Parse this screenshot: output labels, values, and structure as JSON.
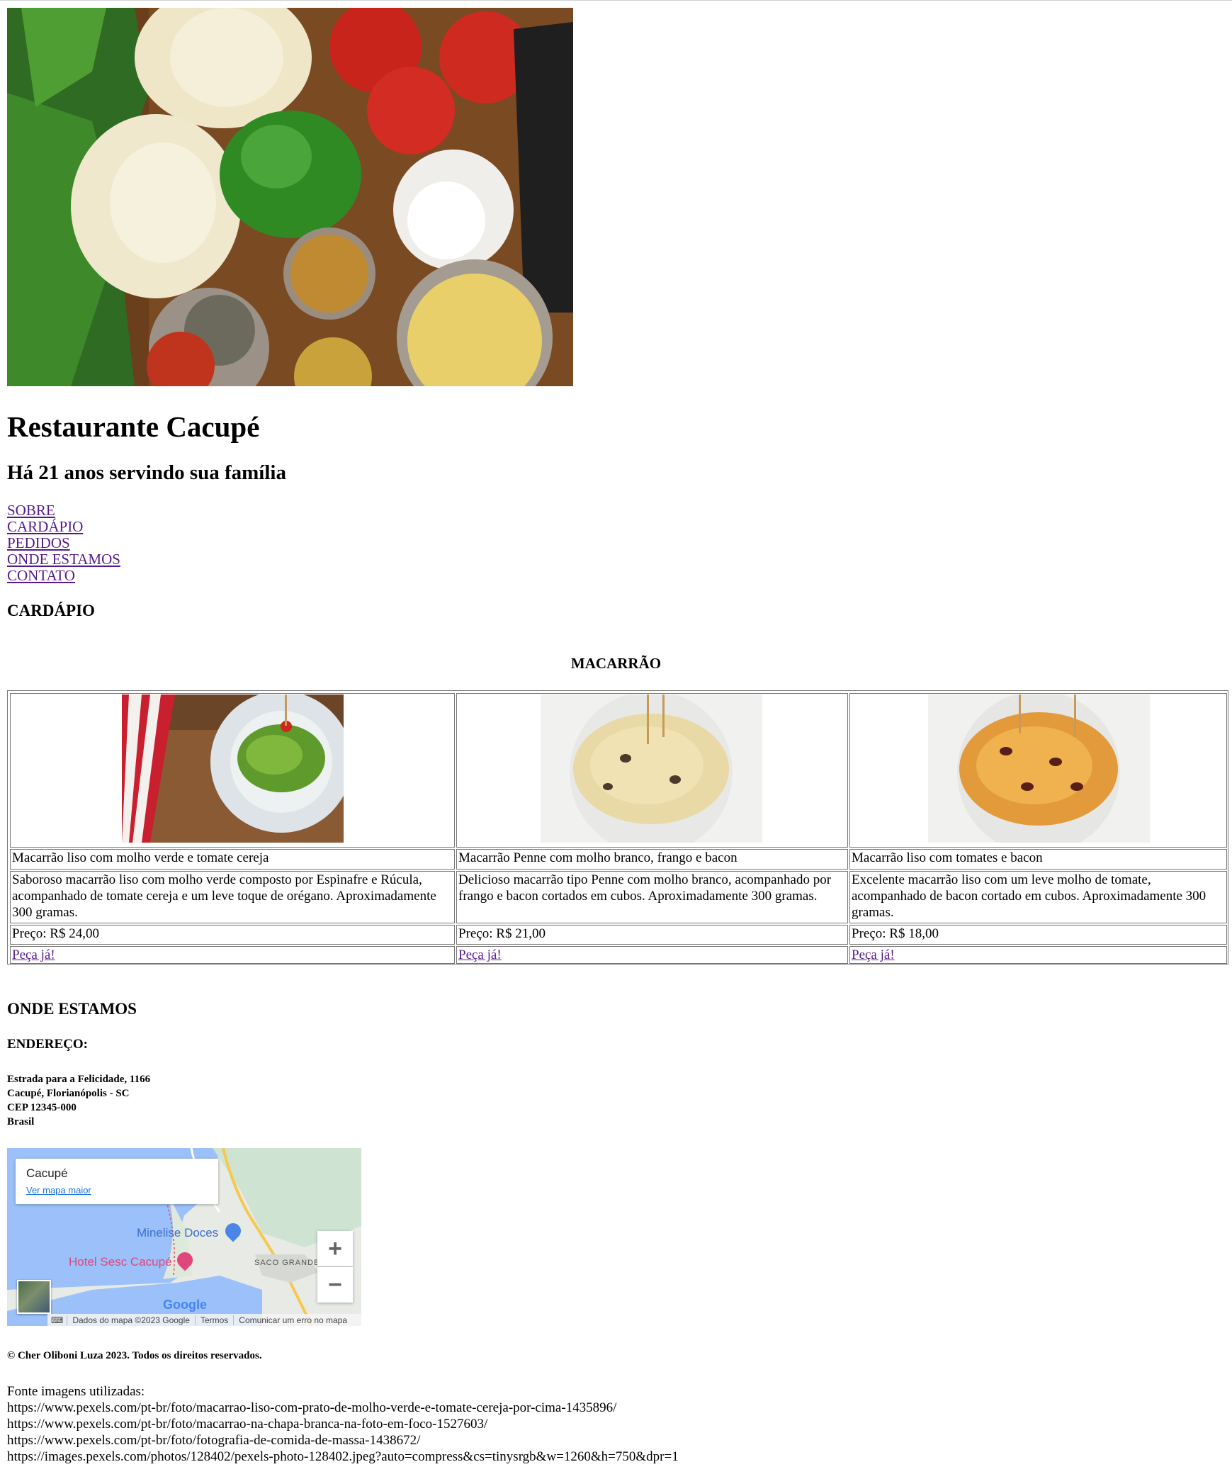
{
  "header": {
    "title": "Restaurante Cacupé",
    "subtitle": "Há 21 anos servindo sua família"
  },
  "nav": {
    "items": [
      {
        "label": "SOBRE"
      },
      {
        "label": "CARDÁPIO"
      },
      {
        "label": "PEDIDOS"
      },
      {
        "label": "ONDE ESTAMOS"
      },
      {
        "label": "CONTATO"
      }
    ]
  },
  "menu": {
    "heading": "CARDÁPIO",
    "category": "MACARRÃO",
    "dishes": [
      {
        "name": "Macarrão liso com molho verde e tomate cereja",
        "description": "Saboroso macarrão liso com molho verde composto por Espinafre e Rúcula, acompanhado de tomate cereja e um leve toque de orégano. Aproximadamente 300 gramas.",
        "price": "Preço: R$ 24,00",
        "order_label": "Peça já!"
      },
      {
        "name": "Macarrão Penne com molho branco, frango e bacon",
        "description": "Delicioso macarrão tipo Penne com molho branco, acompanhado por frango e bacon cortados em cubos. Aproximadamente 300 gramas.",
        "price": "Preço: R$ 21,00",
        "order_label": "Peça já!"
      },
      {
        "name": "Macarrão liso com tomates e bacon",
        "description": "Excelente macarrão liso com um leve molho de tomate, acompanhado de bacon cortado em cubos. Aproximadamente 300 gramas.",
        "price": "Preço: R$ 18,00",
        "order_label": "Peça já!"
      }
    ]
  },
  "location": {
    "heading": "ONDE ESTAMOS",
    "address_heading": "ENDEREÇO:",
    "address_lines": [
      "Estrada para a Felicidade, 1166",
      "Cacupé, Florianópolis - SC",
      "CEP 12345-000",
      "Brasil"
    ],
    "map": {
      "place_name": "Cacupé",
      "larger_map_link": "Ver mapa maior",
      "labels": {
        "poi_1": "Minelise Doces",
        "poi_2": "Hotel Sesc Cacupé",
        "area": "SACO GRANDE",
        "brand": "Google"
      },
      "zoom_in": "+",
      "zoom_out": "−",
      "footer": {
        "data": "Dados do mapa ©2023 Google",
        "terms": "Termos",
        "report": "Comunicar um erro no mapa"
      },
      "icons": [
        "shopping-bag-icon",
        "hotel-bed-icon",
        "keyboard-icon"
      ]
    }
  },
  "footer": {
    "copyright": "© Cher Oliboni Luza 2023. Todos os direitos reservados.",
    "sources_label": "Fonte imagens utilizadas:",
    "sources": [
      "https://www.pexels.com/pt-br/foto/macarrao-liso-com-prato-de-molho-verde-e-tomate-cereja-por-cima-1435896/",
      "https://www.pexels.com/pt-br/foto/macarrao-na-chapa-branca-na-foto-em-foco-1527603/",
      "https://www.pexels.com/pt-br/foto/fotografia-de-comida-de-massa-1438672/",
      "https://images.pexels.com/photos/128402/pexels-photo-128402.jpeg?auto=compress&cs=tinysrgb&w=1260&h=750&dpr=1"
    ]
  },
  "colors": {
    "link_visited": "#551a8b",
    "table_border": "#777777",
    "map_water": "#9cc0f9",
    "map_land": "#e8eae6",
    "map_link": "#1a73e8"
  }
}
